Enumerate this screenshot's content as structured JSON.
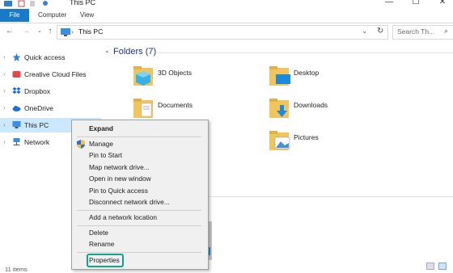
{
  "window": {
    "title": "This PC",
    "min": "—",
    "max": "☐",
    "close": "✕"
  },
  "ribbon": {
    "tabs": [
      "File",
      "Computer",
      "View"
    ]
  },
  "address": {
    "path": "This PC",
    "search_placeholder": "Search Th..."
  },
  "nav": {
    "items": [
      {
        "label": "Quick access",
        "icon": "star-icon"
      },
      {
        "label": "Creative Cloud Files",
        "icon": "creative-cloud-icon"
      },
      {
        "label": "Dropbox",
        "icon": "dropbox-icon"
      },
      {
        "label": "OneDrive",
        "icon": "onedrive-icon"
      },
      {
        "label": "This PC",
        "icon": "computer-icon"
      },
      {
        "label": "Network",
        "icon": "network-icon"
      }
    ]
  },
  "content": {
    "section_title": "Folders (7)",
    "folders": [
      {
        "label": "3D Objects",
        "icon": "3d-objects-folder-icon"
      },
      {
        "label": "Desktop",
        "icon": "desktop-folder-icon"
      },
      {
        "label": "Documents",
        "icon": "documents-folder-icon"
      },
      {
        "label": "Downloads",
        "icon": "downloads-folder-icon"
      },
      {
        "label": "Pictures",
        "icon": "pictures-folder-icon"
      }
    ]
  },
  "status": {
    "items_text": "11 items"
  },
  "context_menu": {
    "items": [
      "Expand",
      "Manage",
      "Pin to Start",
      "Map network drive...",
      "Open in new window",
      "Pin to Quick access",
      "Disconnect network drive...",
      "Add a network location",
      "Delete",
      "Rename",
      "Properties"
    ]
  },
  "colors": {
    "accent": "#1979ca",
    "selection": "#cce8ff",
    "highlight": "#0fa38e",
    "folder": "#f2c55c"
  }
}
